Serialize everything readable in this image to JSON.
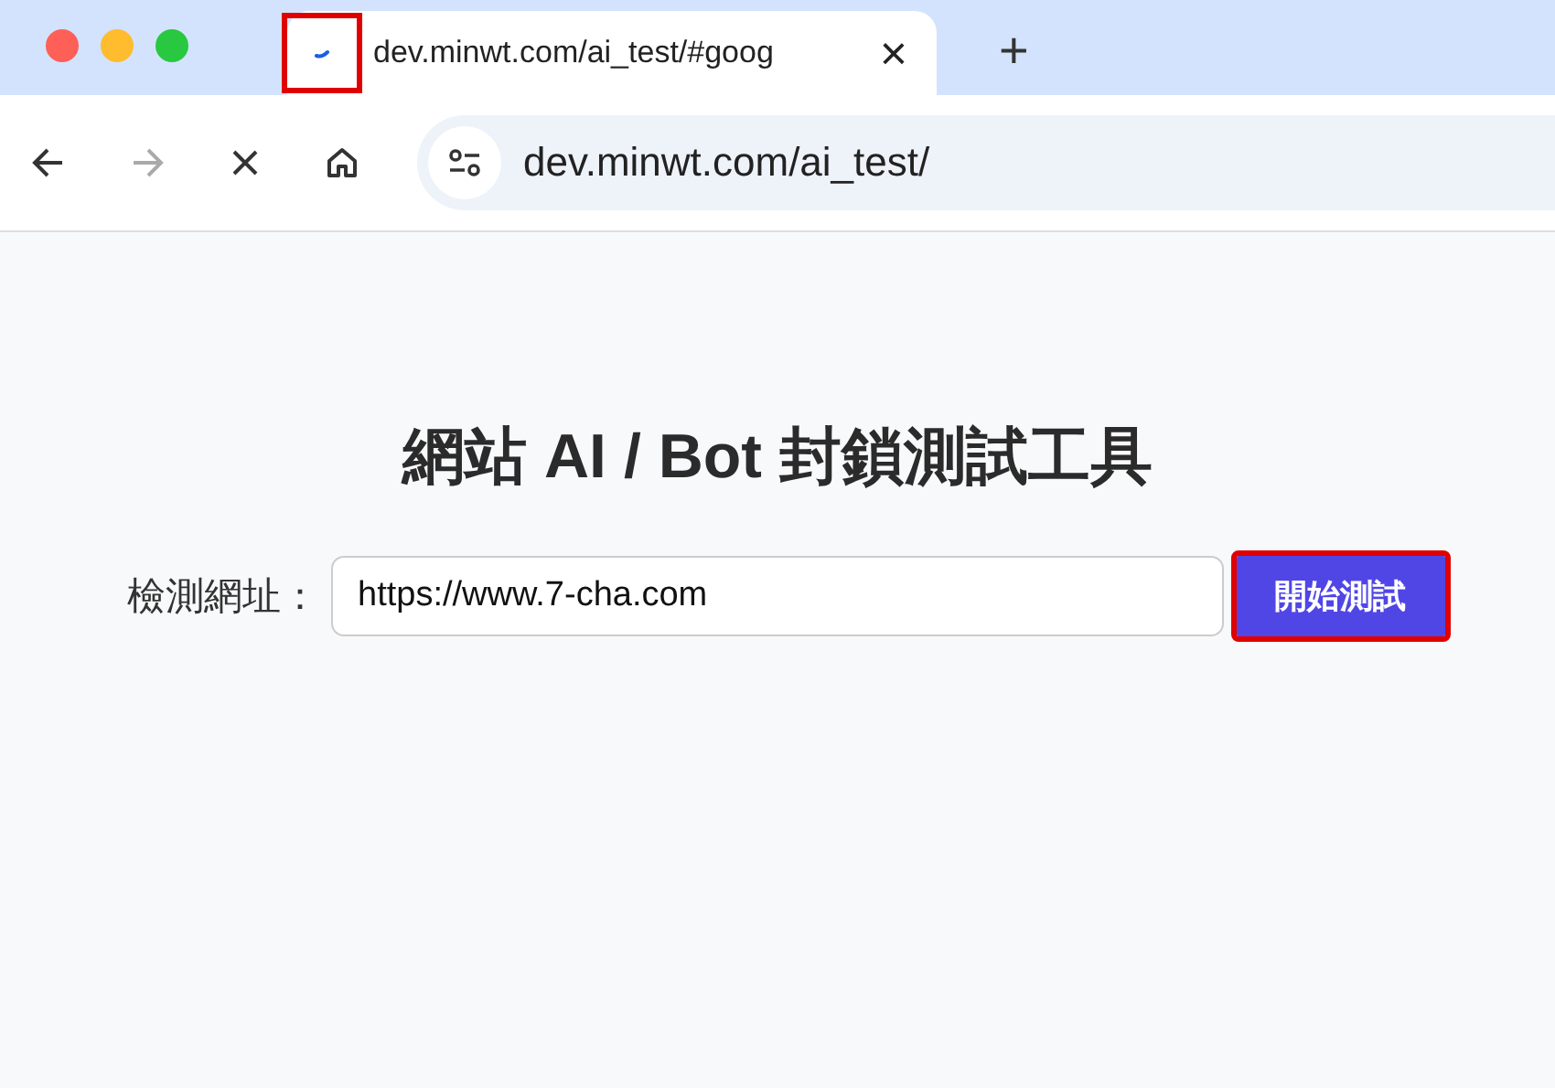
{
  "tabs": [
    {
      "title": "dev.minwt.com/ai_test/#goog",
      "loading": true,
      "highlighted": true,
      "selected": true,
      "close": "×"
    }
  ],
  "new_tab": "+",
  "toolbar": {
    "address": "dev.minwt.com/ai_test/",
    "forward_disabled": true
  },
  "page": {
    "heading": "網站 AI / Bot 封鎖測試工具",
    "label": "檢測網址：",
    "url_value": "https://www.7-cha.com",
    "button": {
      "label": "開始測試",
      "highlighted": true
    }
  }
}
